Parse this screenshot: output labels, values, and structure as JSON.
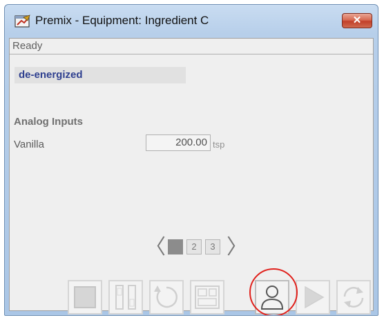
{
  "window": {
    "title": "Premix - Equipment: Ingredient C",
    "close_glyph": "✕"
  },
  "status": {
    "text": "Ready"
  },
  "state": {
    "text": "de-energized"
  },
  "analog_inputs": {
    "section_title": "Analog Inputs",
    "rows": [
      {
        "label": "Vanilla",
        "value": "200.00",
        "units": "tsp"
      }
    ]
  },
  "pager": {
    "prev_glyph": "〈",
    "next_glyph": "〉",
    "pages": [
      "1",
      "2",
      "3"
    ],
    "current_page": 1
  },
  "toolbar": {
    "buttons": [
      {
        "icon": "stop-icon",
        "enabled": false
      },
      {
        "icon": "pause-hold-icon",
        "enabled": false
      },
      {
        "icon": "reset-icon",
        "enabled": false
      },
      {
        "icon": "faceplate-layout-icon",
        "enabled": false
      },
      {
        "icon": "operator-user-icon",
        "enabled": true
      },
      {
        "icon": "play-icon",
        "enabled": false
      },
      {
        "icon": "restart-icon",
        "enabled": false
      }
    ]
  },
  "colors": {
    "highlight_circle": "#e0201b",
    "state_text": "#2e3f8f",
    "close_button": "#c2402a"
  }
}
